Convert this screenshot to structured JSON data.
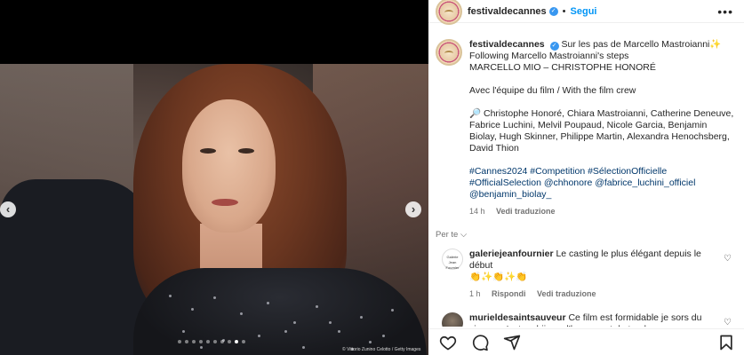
{
  "header": {
    "username": "festivaldecannes",
    "separator": "•",
    "follow_label": "Segui",
    "more_label": "•••"
  },
  "caption": {
    "username": "festivaldecannes",
    "line1": "Sur les pas de Marcello Mastroianni✨",
    "line2": "Following Marcello Mastroianni's steps",
    "line3": "MARCELLO MIO – CHRISTOPHE HONORÉ",
    "line4": "Avec l'équipe du film / With the film crew",
    "cast": "🔎 Christophe Honoré, Chiara Mastroianni, Catherine Deneuve, Fabrice Luchini, Melvil Poupaud, Nicole Garcia, Benjamin Biolay, Hugh Skinner, Philippe Martin, Alexandra Henochsberg, David Thion",
    "hashtags_line1": "#Cannes2024 #Competition #SélectionOfficielle",
    "hashtags_line2": "#OfficialSelection @chhonore @fabrice_luchini_officiel",
    "hashtags_line3": "@benjamin_biolay_",
    "time": "14 h",
    "translate": "Vedi traduzione"
  },
  "for_you": "Per te ⌵",
  "comments": [
    {
      "username": "galeriejeanfournier",
      "text": "Le casting le plus élégant depuis le début",
      "emojis": "👏✨👏✨👏",
      "time": "1 h",
      "reply": "Rispondi",
      "translate": "Vedi traduzione"
    },
    {
      "username": "murieldesaintsauveur",
      "text": "Ce film est formidable je sors du cinema c'est un bijoux d'humour et de tendresse"
    }
  ],
  "media": {
    "credit": "© Vittorio Zunino Celotto / Getty Images",
    "slide_count": 10,
    "active_slide": 8
  },
  "icons": {
    "heart": "heart-icon",
    "comment": "comment-icon",
    "share": "share-icon",
    "save": "bookmark-icon"
  },
  "colors": {
    "accent": "#0095f6",
    "verified": "#3897f0",
    "link": "#00376b"
  }
}
